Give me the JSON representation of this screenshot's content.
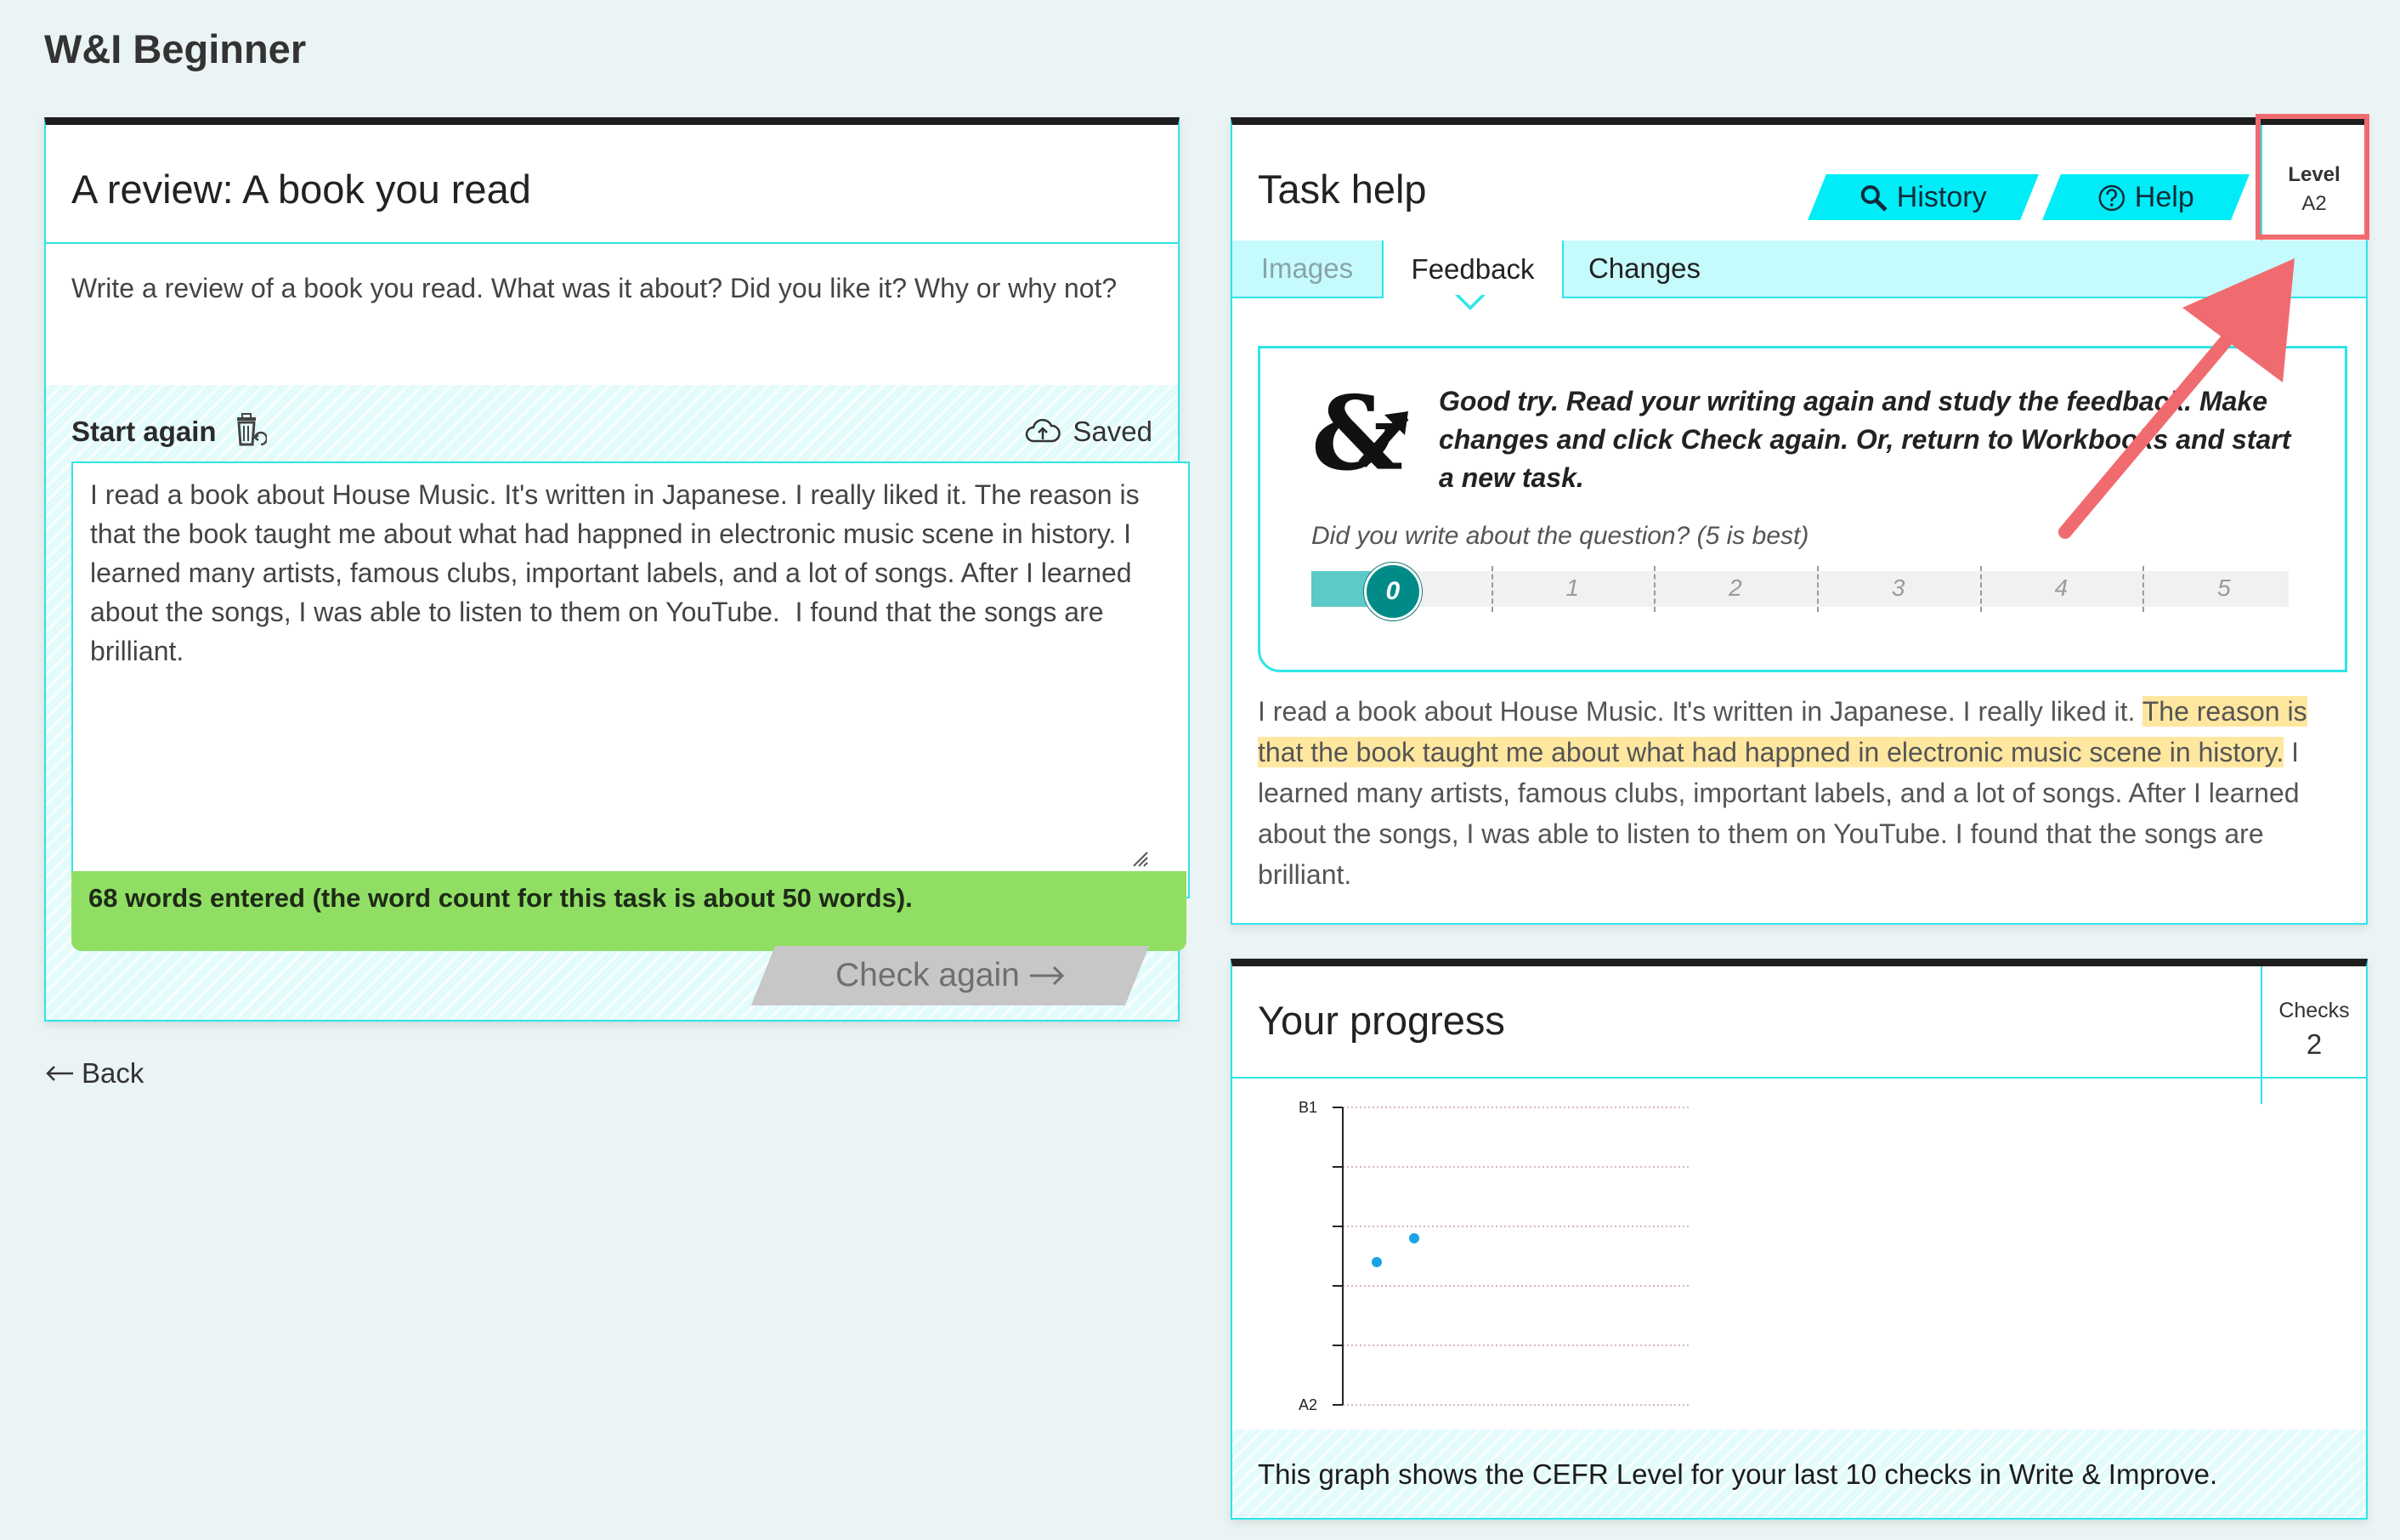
{
  "app_title": "W&I Beginner",
  "task": {
    "title": "A review: A book you read",
    "prompt": "Write a review of a book you read. What was it about? Did you like it? Why or why not?",
    "start_again_label": "Start again",
    "saved_label": "Saved",
    "essay_text": "I read a book about House Music. It's written in Japanese. I really liked it. The reason is that the book taught me about what had happned in electronic music scene in history. I learned many artists, famous clubs, important labels, and a lot of songs. After I learned about the songs, I was able to listen to them on YouTube.  I found that the songs are brilliant.",
    "word_count_message": "68 words entered (the word count for this task is about 50 words).",
    "check_again_label": "Check again"
  },
  "back_label": "Back",
  "task_help": {
    "title": "Task help",
    "history_label": "History",
    "help_label": "Help",
    "level_label": "Level",
    "level_value": "A2",
    "tabs": [
      {
        "label": "Images",
        "state": "inactive"
      },
      {
        "label": "Feedback",
        "state": "active"
      },
      {
        "label": "Changes",
        "state": "normal"
      }
    ],
    "feedback_message": "Good try. Read your writing again and study the feedback. Make changes and click Check again. Or, return to Workbooks and start a new task.",
    "question": "Did you write about the question? (5 is best)",
    "scale_value": 0,
    "scale_labels": [
      "0",
      "1",
      "2",
      "3",
      "4",
      "5"
    ],
    "text_before": "I read a book about House Music. It's written in Japanese. I really liked it. ",
    "text_highlight": "The reason is that the book taught me about what had happned in electronic music scene in history.",
    "text_after": " I learned many artists, famous clubs, important labels, and a lot of songs. After I learned about the songs, I was able to listen to them on YouTube.  I found that the songs are brilliant."
  },
  "progress": {
    "title": "Your progress",
    "checks_label": "Checks",
    "checks_value": "2",
    "graph_note": "This graph shows the CEFR Level for your last 10 checks in Write & Improve."
  },
  "chart_data": {
    "type": "scatter",
    "y_tick_labels": [
      "A2",
      "B1"
    ],
    "ylim": [
      0,
      5
    ],
    "grid": true,
    "x": [
      1,
      2
    ],
    "y": [
      2.4,
      2.8
    ],
    "point_color": "#1aa3e8"
  },
  "colors": {
    "accent": "#2ee4e8",
    "button_cyan": "#00ecf6",
    "word_count_green": "#90df64",
    "highlight": "#ffe7a0",
    "annotation_red": "#f06b6f"
  },
  "icons": {
    "start_again": "trash-icon",
    "saved": "cloud-upload-icon",
    "history": "search-icon",
    "help": "question-circle-icon",
    "brand": "ampersand-arrow-icon",
    "back": "arrow-left-icon",
    "check_again": "arrow-right-icon"
  }
}
